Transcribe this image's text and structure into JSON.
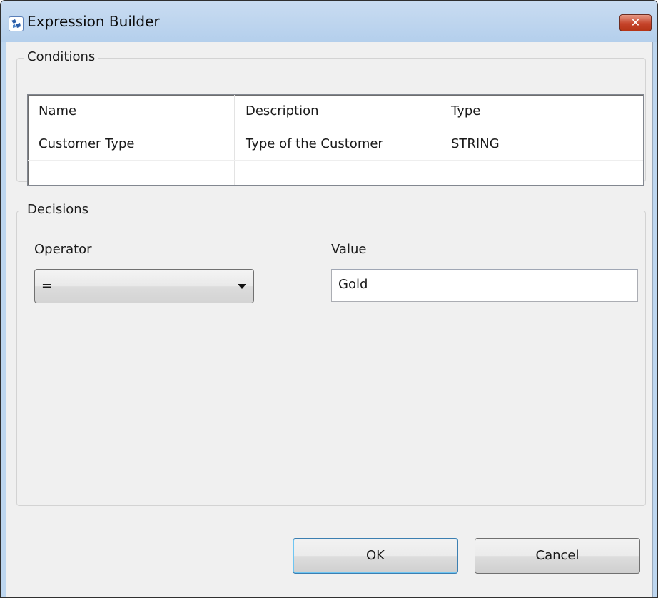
{
  "window": {
    "title": "Expression Builder",
    "close_label": "✕"
  },
  "conditions": {
    "legend": "Conditions",
    "columns": [
      "Name",
      "Description",
      "Type"
    ],
    "rows": [
      [
        "Customer Type",
        "Type of the Customer",
        "STRING"
      ],
      [
        "",
        "",
        ""
      ]
    ]
  },
  "decisions": {
    "legend": "Decisions",
    "operator_label": "Operator",
    "operator_value": "=",
    "value_label": "Value",
    "value_text": "Gold"
  },
  "buttons": {
    "ok": "OK",
    "cancel": "Cancel"
  },
  "colors": {
    "titlebar": "#b4cfec",
    "close": "#c5432a",
    "client": "#f0f0f0"
  }
}
